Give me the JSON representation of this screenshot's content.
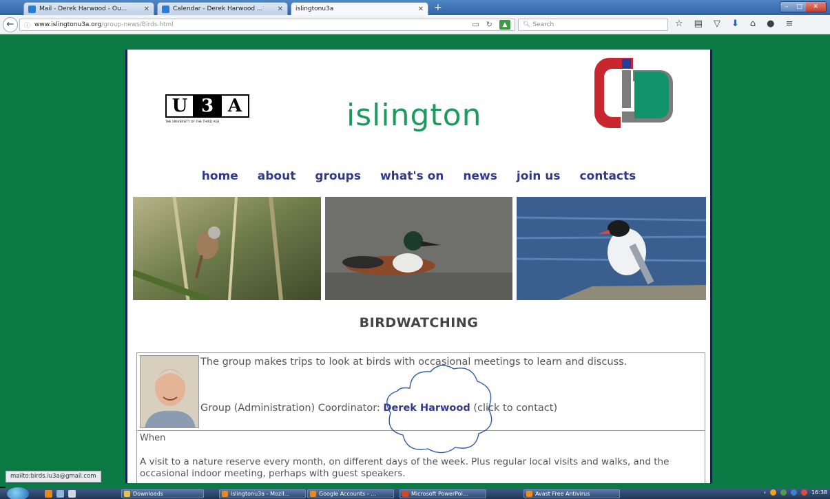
{
  "browser": {
    "tabs": [
      {
        "title": "Mail - Derek Harwood - Ou...",
        "active": false,
        "icon_color": "#2a7bd1"
      },
      {
        "title": "Calendar - Derek Harwood ...",
        "active": false,
        "icon_color": "#2a7bd1"
      },
      {
        "title": "islingtonu3a",
        "active": true,
        "icon_color": ""
      }
    ],
    "url_domain": "www.islingtonu3a.org",
    "url_path": "/group-news/Birds.html",
    "search_placeholder": "Search",
    "status_link": "mailto:birds.iu3a@gmail.com"
  },
  "site": {
    "u3a_letters": [
      "U",
      "3",
      "A"
    ],
    "u3a_tagline": "THE UNIVERSITY OF THE THIRD AGE",
    "brand": "islington",
    "nav": [
      "home",
      "about",
      "groups",
      "what's on",
      "news",
      "join us",
      "contacts"
    ]
  },
  "group": {
    "heading": "BIRDWATCHING",
    "description": "The group makes trips to look at birds with occasional meetings to learn and discuss.",
    "coordinator_prefix": "Group (Administration) Coordinator: ",
    "coordinator_name": "Derek Harwood",
    "coordinator_suffix": " (click to contact)",
    "when_label": "When",
    "visit_text": "A visit to a nature reserve every month, on different days of the week. Plus regular local visits and walks, and the occasional indoor meeting, perhaps with guest speakers."
  },
  "taskbar": {
    "items": [
      "Downloads",
      "islingtonu3a - Mozil...",
      "Google Accounts - ...",
      "Microsoft PowerPoi...",
      "Avast Free Antivirus"
    ],
    "clock": "16:38"
  },
  "colors": {
    "background_green": "#0b7a45",
    "brand_green": "#1d9a5e",
    "nav_blue": "#313a8c"
  }
}
